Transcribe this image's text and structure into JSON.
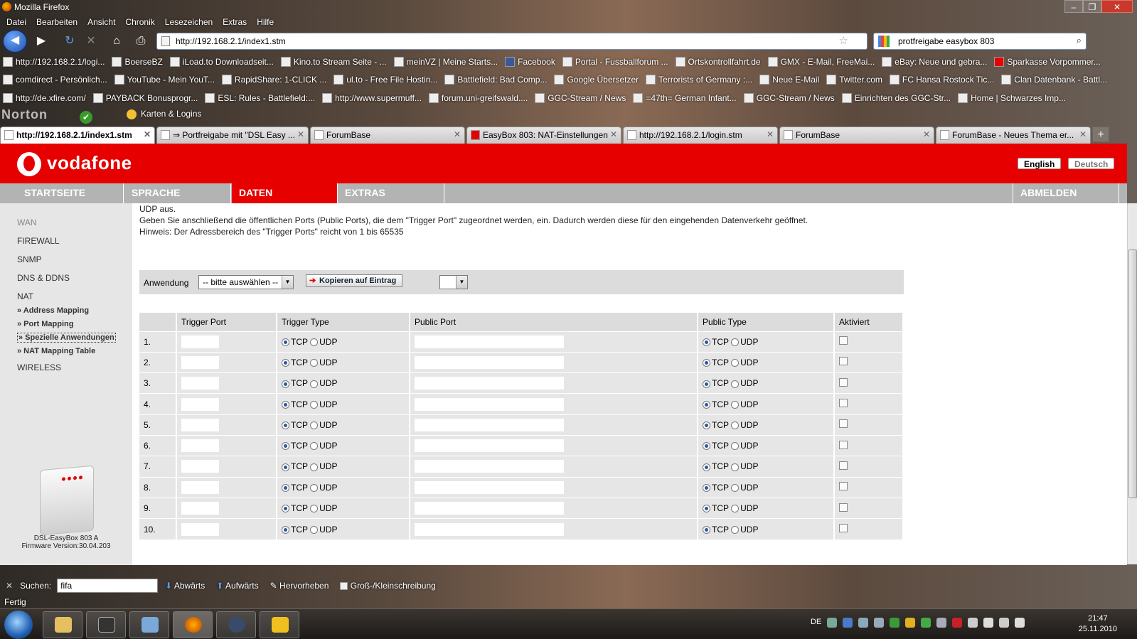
{
  "window": {
    "title": "Mozilla Firefox"
  },
  "menu": [
    "Datei",
    "Bearbeiten",
    "Ansicht",
    "Chronik",
    "Lesezeichen",
    "Extras",
    "Hilfe"
  ],
  "urlbar": {
    "url": "http://192.168.2.1/index1.stm"
  },
  "searchbar": {
    "value": "protfreigabe easybox 803"
  },
  "bookmarks": {
    "row1": [
      "http://192.168.2.1/logi...",
      "BoerseBZ",
      "iLoad.to Downloadseit...",
      "Kino.to Stream Seite - ...",
      "meinVZ | Meine Starts...",
      "Facebook",
      "Portal - Fussballforum ...",
      "Ortskontrollfahrt.de",
      "GMX - E-Mail, FreeMai...",
      "eBay: Neue und gebra...",
      "Sparkasse Vorpommer..."
    ],
    "row2": [
      "comdirect - Persönlich...",
      "YouTube - Mein YouT...",
      "RapidShare: 1-CLICK ...",
      "ul.to - Free File Hostin...",
      "Battlefield: Bad Comp...",
      "Google Übersetzer",
      "Terrorists of Germany :...",
      "Neue E-Mail",
      "Twitter.com",
      "FC Hansa Rostock Tic...",
      "Clan Datenbank - Battl..."
    ],
    "row3": [
      "http://de.xfire.com/",
      "PAYBACK Bonusprogr...",
      "ESL: Rules - Battlefield:...",
      "http://www.supermuff...",
      "forum.uni-greifswald....",
      "GGC-Stream / News",
      "=47th= German Infant...",
      "GGC-Stream / News",
      "Einrichten des GGC-Str...",
      "Home | Schwarzes Imp..."
    ]
  },
  "toolbar4": {
    "norton": "Norton",
    "karten": "Karten & Logins"
  },
  "tabs": [
    "http://192.168.2.1/index1.stm",
    "⇒ Portfreigabe mit \"DSL Easy ...",
    "ForumBase",
    "EasyBox 803: NAT-Einstellungen",
    "http://192.168.2.1/login.stm",
    "ForumBase",
    "ForumBase - Neues Thema er..."
  ],
  "vf": {
    "brand": "vodafone",
    "lang": {
      "english": "English",
      "deutsch": "Deutsch"
    },
    "nav": {
      "startseite": "STARTSEITE",
      "sprache": "SPRACHE",
      "daten": "DATEN",
      "extras": "EXTRAS",
      "abmelden": "ABMELDEN"
    },
    "sidebar": {
      "wan": "WAN",
      "firewall": "FIREWALL",
      "snmp": "SNMP",
      "dns": "DNS & DDNS",
      "nat": "NAT",
      "sub": [
        "» Address Mapping",
        "» Port Mapping",
        "» Spezielle Anwendungen",
        "» NAT Mapping Table"
      ],
      "wireless": "WIRELESS"
    },
    "device": {
      "name": "DSL-EasyBox 803 A",
      "firmware": "Firmware Version:30.04.203"
    },
    "text": {
      "line1": "UDP aus.",
      "line2": "Geben Sie anschließend die öffentlichen Ports (Public Ports), die dem \"Trigger Port\" zugeordnet werden, ein. Dadurch werden diese für den eingehenden Datenverkehr geöffnet.",
      "line3": "Hinweis: Der Adressbereich des \"Trigger Ports\" reicht von 1 bis 65535"
    },
    "appbar": {
      "label": "Anwendung",
      "select": "-- bitte auswählen --",
      "copy": "Kopieren auf Eintrag"
    },
    "table": {
      "headers": [
        "",
        "Trigger Port",
        "Trigger Type",
        "Public Port",
        "Public Type",
        "Aktiviert"
      ],
      "rows": [
        "1.",
        "2.",
        "3.",
        "4.",
        "5.",
        "6.",
        "7.",
        "8.",
        "9.",
        "10."
      ],
      "tcp": "TCP",
      "udp": "UDP"
    }
  },
  "findbar": {
    "label": "Suchen:",
    "value": "fifa",
    "down": "Abwärts",
    "up": "Aufwärts",
    "highlight": "Hervorheben",
    "case": "Groß-/Kleinschreibung"
  },
  "status": "Fertig",
  "taskbar": {
    "lang": "DE",
    "time": "21:47",
    "date": "25.11.2010"
  }
}
